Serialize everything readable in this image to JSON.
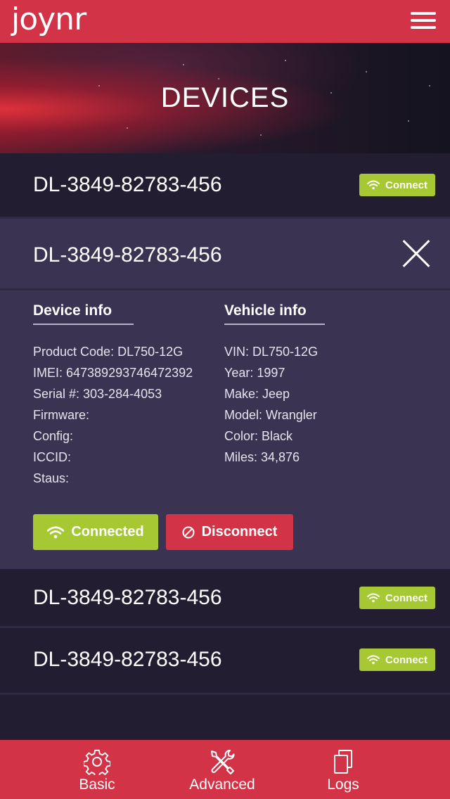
{
  "app": {
    "logo": "joynr"
  },
  "hero": {
    "title": "DEVICES"
  },
  "colors": {
    "brand_red": "#d33347",
    "connect_green": "#a6c832",
    "background": "#221d31",
    "expanded_bg": "#3b3352"
  },
  "devices": [
    {
      "id": "DL-3849-82783-456",
      "action_label": "Connect"
    },
    {
      "id": "DL-3849-82783-456"
    },
    {
      "id": "DL-3849-82783-456",
      "action_label": "Connect"
    },
    {
      "id": "DL-3849-82783-456",
      "action_label": "Connect"
    }
  ],
  "expanded": {
    "device_info_title": "Device info",
    "vehicle_info_title": "Vehicle info",
    "device_info": [
      "Product Code: DL750-12G",
      "IMEI: 647389293746472392",
      "Serial #: 303-284-4053",
      "Firmware:",
      "Config:",
      "ICCID:",
      "Staus:"
    ],
    "vehicle_info": [
      "VIN: DL750-12G",
      "Year: 1997",
      "Make: Jeep",
      "Model: Wrangler",
      "Color: Black",
      "Miles: 34,876"
    ],
    "connected_label": "Connected",
    "disconnect_label": "Disconnect"
  },
  "nav": [
    {
      "label": "Basic",
      "icon": "gear-icon"
    },
    {
      "label": "Advanced",
      "icon": "tools-icon"
    },
    {
      "label": "Logs",
      "icon": "copy-icon"
    }
  ]
}
